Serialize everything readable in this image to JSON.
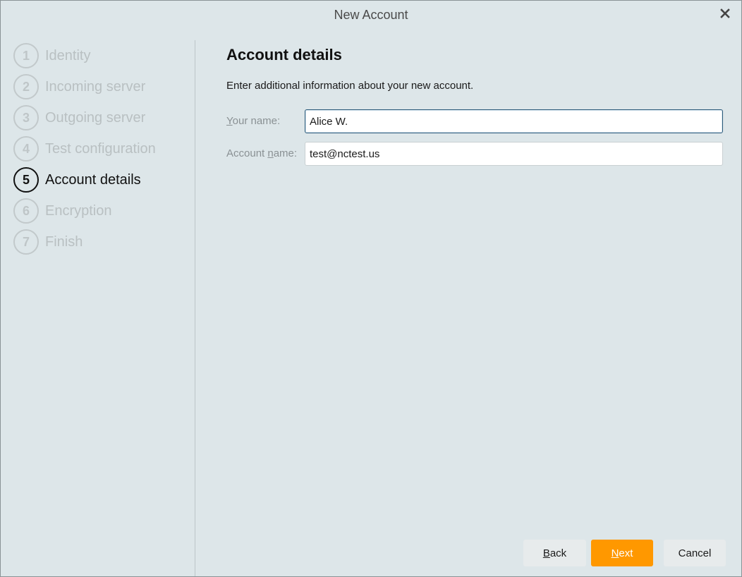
{
  "window": {
    "title": "New Account",
    "close_icon": "close-icon"
  },
  "steps": [
    {
      "number": "1",
      "label": "Identity",
      "state": "inactive"
    },
    {
      "number": "2",
      "label": "Incoming server",
      "state": "inactive"
    },
    {
      "number": "3",
      "label": "Outgoing server",
      "state": "inactive"
    },
    {
      "number": "4",
      "label": "Test configuration",
      "state": "inactive"
    },
    {
      "number": "5",
      "label": "Account details",
      "state": "active"
    },
    {
      "number": "6",
      "label": "Encryption",
      "state": "inactive"
    },
    {
      "number": "7",
      "label": "Finish",
      "state": "inactive"
    }
  ],
  "main": {
    "heading": "Account details",
    "description": "Enter additional information about your new account.",
    "fields": {
      "your_name": {
        "label_mnemonic": "Y",
        "label_rest": "our name:",
        "value": "Alice W."
      },
      "account_name": {
        "label_prefix": "Account ",
        "label_mnemonic": "n",
        "label_rest": "ame:",
        "value": "test@nctest.us"
      }
    }
  },
  "buttons": {
    "back": {
      "mnemonic": "B",
      "rest": "ack"
    },
    "next": {
      "mnemonic": "N",
      "rest": "ext"
    },
    "cancel": {
      "label": "Cancel"
    }
  },
  "colors": {
    "background": "#dde6e9",
    "accent": "#ff9800",
    "active_step": "#111111",
    "inactive_step": "#b9c0c2"
  }
}
